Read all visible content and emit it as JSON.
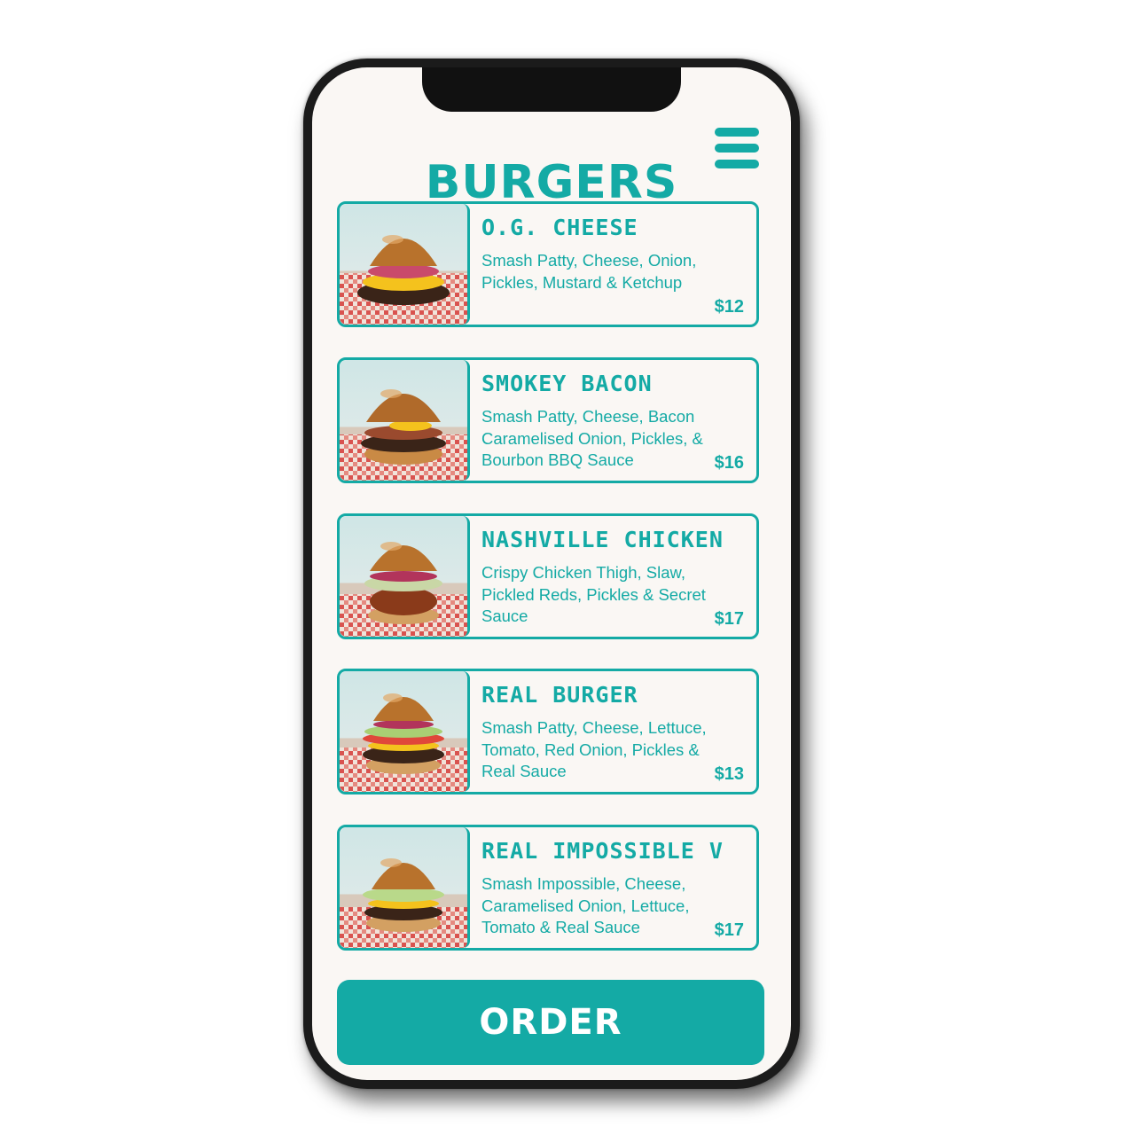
{
  "page": {
    "title": "BURGERS",
    "menu_icon": "hamburger-menu-icon"
  },
  "theme": {
    "accent": "#14aaa5",
    "background": "#faf7f4",
    "button_text": "#ffffff"
  },
  "items": [
    {
      "name": "O.G. CHEESE",
      "description": "Smash Patty, Cheese, Onion, Pickles, Mustard & Ketchup",
      "price": "$12"
    },
    {
      "name": "SMOKEY BACON",
      "description": "Smash Patty, Cheese, Bacon Caramelised Onion, Pickles, & Bourbon BBQ Sauce",
      "price": "$16"
    },
    {
      "name": "NASHVILLE CHICKEN",
      "description": "Crispy Chicken Thigh, Slaw, Pickled Reds, Pickles & Secret Sauce",
      "price": "$17"
    },
    {
      "name": "REAL BURGER",
      "description": "Smash Patty, Cheese, Lettuce, Tomato, Red Onion, Pickles & Real Sauce",
      "price": "$13"
    },
    {
      "name": "REAL IMPOSSIBLE V",
      "description": "Smash Impossible, Cheese, Caramelised Onion, Lettuce, Tomato & Real Sauce",
      "price": "$17"
    }
  ],
  "order_button": {
    "label": "ORDER"
  }
}
